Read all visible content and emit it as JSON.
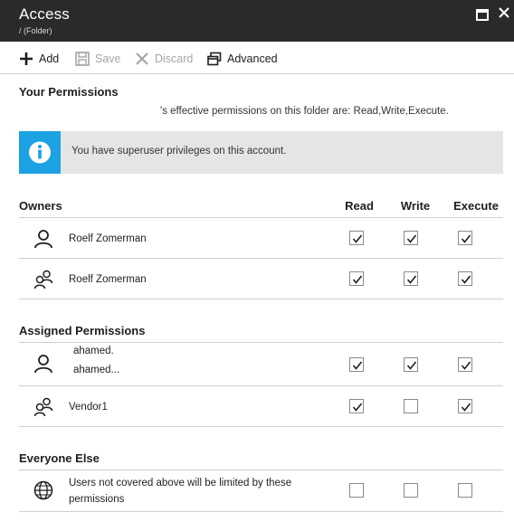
{
  "window": {
    "title": "Access",
    "subtitle": "/ (Folder)"
  },
  "toolbar": {
    "add_label": "Add",
    "save_label": "Save",
    "discard_label": "Discard",
    "advanced_label": "Advanced"
  },
  "your_permissions": {
    "heading": "Your Permissions",
    "effective_text": "'s effective permissions on this folder are: Read,Write,Execute.",
    "info_text": "You have superuser privileges on this account."
  },
  "columns": {
    "read": "Read",
    "write": "Write",
    "execute": "Execute"
  },
  "owners": {
    "heading": "Owners",
    "rows": [
      {
        "icon": "user-icon",
        "name": "Roelf Zomerman",
        "read": true,
        "write": true,
        "execute": true
      },
      {
        "icon": "group-icon",
        "name": "Roelf Zomerman",
        "read": true,
        "write": true,
        "execute": true
      }
    ]
  },
  "assigned": {
    "heading": "Assigned Permissions",
    "rows": [
      {
        "icon": "user-icon",
        "name_line1": "ahamed.",
        "name_line2": "ahamed...",
        "read": true,
        "write": true,
        "execute": true
      },
      {
        "icon": "group-icon",
        "name": "Vendor1",
        "read": true,
        "write": false,
        "execute": true
      }
    ]
  },
  "everyone": {
    "heading": "Everyone Else",
    "rows": [
      {
        "icon": "globe-icon",
        "name_line1": "Users not covered above will be limited by these",
        "name_line2": "permissions",
        "read": false,
        "write": false,
        "execute": false
      }
    ]
  },
  "colors": {
    "titlebar": "#2a2a2a",
    "info_accent": "#1ca1e2",
    "info_bg": "#e5e5e5",
    "divider": "#cfcfcf"
  }
}
